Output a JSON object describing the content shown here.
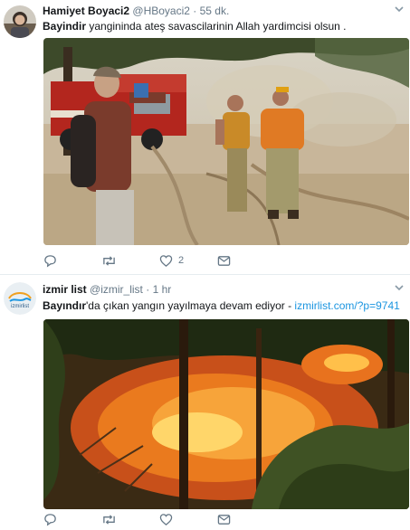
{
  "tweets": [
    {
      "author_name": "Hamiyet Boyaci2",
      "handle": "@HBoyaci2",
      "separator": "·",
      "time": "55 dk.",
      "text_bold": "Bayindir",
      "text_rest": " yangininda ateş savascilarinin Allah yardimcisi olsun .",
      "reply_count": "",
      "retweet_count": "",
      "like_count": "2"
    },
    {
      "author_name": "izmir list",
      "handle": "@izmir_list",
      "separator": "·",
      "time": "1 hr",
      "avatar_text": "izmirlist",
      "text_bold": "Bayındır",
      "text_rest": "'da çıkan yangın yayılmaya devam ediyor - ",
      "link": "izmirlist.com/?p=9741",
      "reply_count": "",
      "retweet_count": "",
      "like_count": ""
    }
  ],
  "colors": {
    "name": "#14171a",
    "secondary": "#657786",
    "link": "#1b95e0",
    "divider": "#e6ecf0"
  },
  "icons": [
    "reply-icon",
    "retweet-icon",
    "like-icon",
    "message-icon",
    "chevron-down-icon"
  ]
}
